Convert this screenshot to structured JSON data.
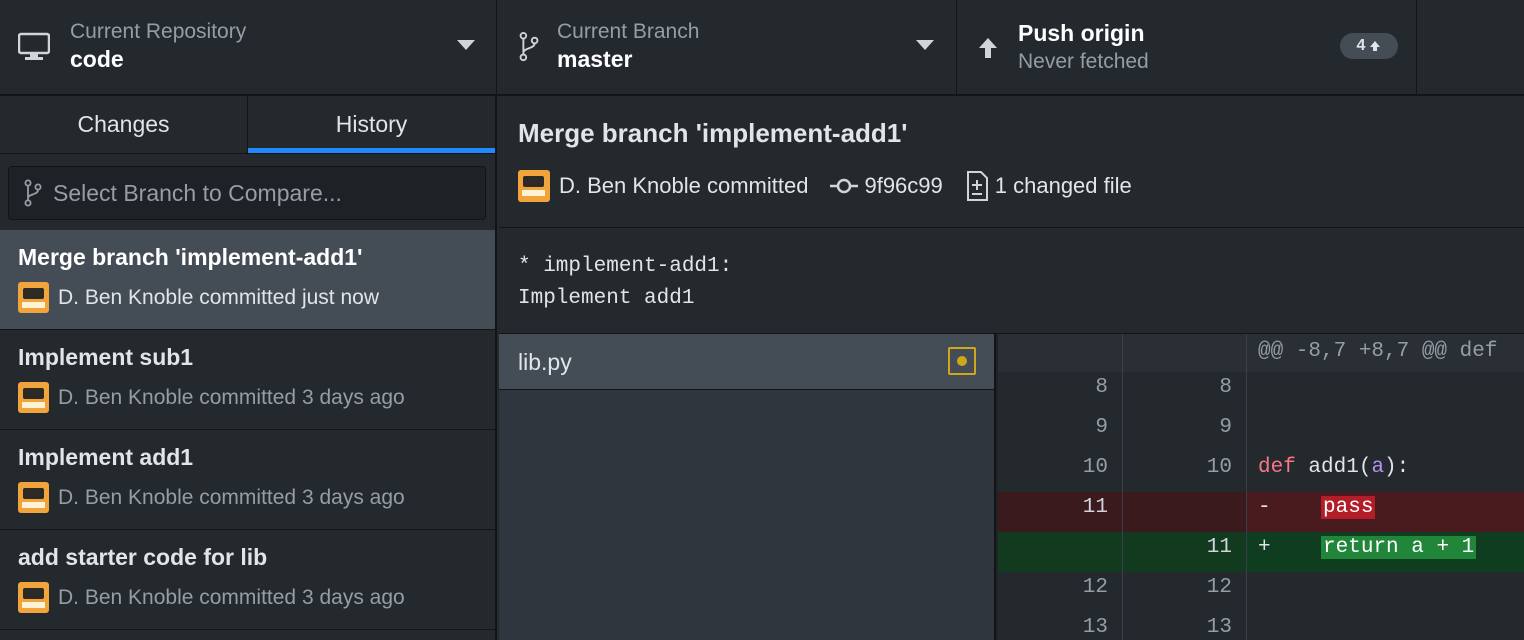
{
  "toolbar": {
    "repository": {
      "label": "Current Repository",
      "value": "code",
      "icon": "desktop-icon"
    },
    "branch": {
      "label": "Current Branch",
      "value": "master",
      "icon": "git-branch-icon"
    },
    "push": {
      "label": "Push origin",
      "status": "Never fetched",
      "badge_count": "4",
      "icon": "arrow-up-icon"
    }
  },
  "sidebar": {
    "tabs": [
      {
        "label": "Changes",
        "active": false
      },
      {
        "label": "History",
        "active": true
      }
    ],
    "branch_filter": {
      "placeholder": "Select Branch to Compare..."
    },
    "commits": [
      {
        "title": "Merge branch 'implement-add1'",
        "author": "D. Ben Knoble",
        "meta": "D. Ben Knoble committed just now",
        "selected": true
      },
      {
        "title": "Implement sub1",
        "author": "D. Ben Knoble",
        "meta": "D. Ben Knoble committed 3 days ago",
        "selected": false
      },
      {
        "title": "Implement add1",
        "author": "D. Ben Knoble",
        "meta": "D. Ben Knoble committed 3 days ago",
        "selected": false
      },
      {
        "title": "add starter code for lib",
        "author": "D. Ben Knoble",
        "meta": "D. Ben Knoble committed 3 days ago",
        "selected": false
      }
    ]
  },
  "detail": {
    "title": "Merge branch 'implement-add1'",
    "author_line": "D. Ben Knoble committed",
    "sha": "9f96c99",
    "files_changed": "1 changed file",
    "body_line1": "* implement-add1:",
    "body_line2": "Implement add1",
    "files": [
      {
        "name": "lib.py",
        "status": "modified"
      }
    ]
  },
  "diff": {
    "hunk_header": "@@ -8,7 +8,7 @@ def",
    "rows": [
      {
        "type": "context",
        "old": "8",
        "new": "8",
        "code": ""
      },
      {
        "type": "context",
        "old": "9",
        "new": "9",
        "code": ""
      },
      {
        "type": "context",
        "old": "10",
        "new": "10",
        "keyword": "def",
        "fn": " add1(",
        "param": "a",
        "rest": "):"
      },
      {
        "type": "del",
        "old": "11",
        "new": "",
        "sign": "-",
        "text": "pass"
      },
      {
        "type": "add",
        "old": "",
        "new": "11",
        "sign": "+",
        "text": "return a + 1"
      },
      {
        "type": "context",
        "old": "12",
        "new": "12",
        "code": ""
      },
      {
        "type": "context",
        "old": "13",
        "new": "13",
        "code": ""
      }
    ]
  },
  "colors": {
    "accent": "#2188ff",
    "deleted": "#b31d28",
    "added": "#22863a",
    "modified": "#d0a71b"
  }
}
